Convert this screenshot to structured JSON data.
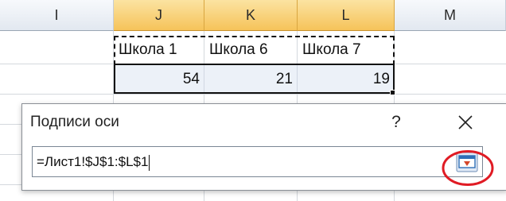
{
  "columns": [
    "I",
    "J",
    "K",
    "L",
    "M"
  ],
  "row1": {
    "J": "Школа 1",
    "K": "Школа 6",
    "L": "Школа 7"
  },
  "row2": {
    "J": "54",
    "K": "21",
    "L": "19"
  },
  "dialog": {
    "title": "Подписи оси",
    "help_label": "?",
    "reference_value": "=Лист1!$J$1:$L$1"
  },
  "icons": {
    "close": "close-icon",
    "collapse": "collapse-dialog-icon"
  },
  "colors": {
    "selected_header": "#f6c35a",
    "highlight_ring": "#e01b24",
    "collapse_icon": "#2f6fb7"
  }
}
